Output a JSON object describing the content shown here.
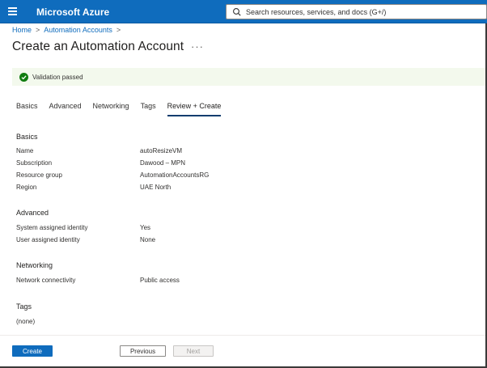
{
  "topbar": {
    "brand": "Microsoft Azure",
    "search_placeholder": "Search resources, services, and docs (G+/)",
    "bg_color": "#0f6cbd"
  },
  "breadcrumb": {
    "items": [
      "Home",
      "Automation Accounts"
    ]
  },
  "page": {
    "title": "Create an Automation Account",
    "more": "···"
  },
  "validation": {
    "text": "Validation passed",
    "status_color": "#107c10"
  },
  "tabs": [
    {
      "label": "Basics",
      "active": false
    },
    {
      "label": "Advanced",
      "active": false
    },
    {
      "label": "Networking",
      "active": false
    },
    {
      "label": "Tags",
      "active": false
    },
    {
      "label": "Review + Create",
      "active": true
    }
  ],
  "sections": {
    "basics": {
      "title": "Basics",
      "rows": [
        {
          "label": "Name",
          "value": "autoResizeVM"
        },
        {
          "label": "Subscription",
          "value": "Dawood – MPN"
        },
        {
          "label": "Resource group",
          "value": "AutomationAccountsRG"
        },
        {
          "label": "Region",
          "value": "UAE North"
        }
      ]
    },
    "advanced": {
      "title": "Advanced",
      "rows": [
        {
          "label": "System assigned identity",
          "value": "Yes"
        },
        {
          "label": "User assigned identity",
          "value": "None"
        }
      ]
    },
    "networking": {
      "title": "Networking",
      "rows": [
        {
          "label": "Network connectivity",
          "value": "Public access"
        }
      ]
    },
    "tags": {
      "title": "Tags",
      "value": "(none)"
    }
  },
  "footer": {
    "create_label": "Create",
    "previous_label": "Previous",
    "next_label": "Next"
  }
}
